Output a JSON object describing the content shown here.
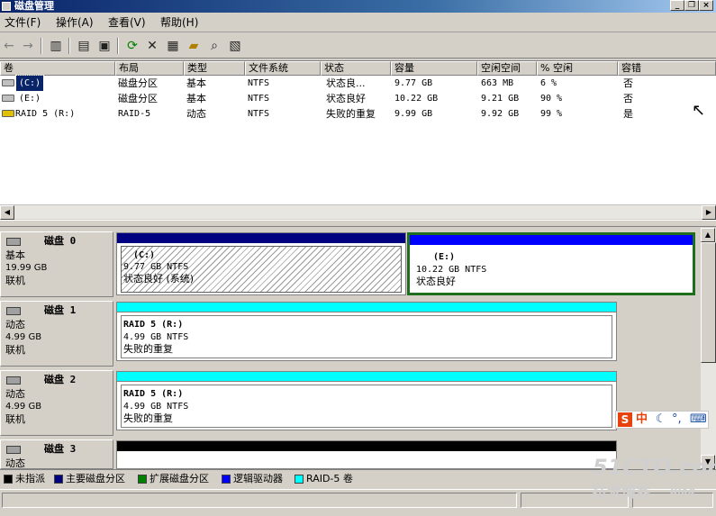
{
  "window": {
    "title": "磁盘管理"
  },
  "menu": {
    "items": [
      "文件(F)",
      "操作(A)",
      "查看(V)",
      "帮助(H)"
    ]
  },
  "toolbar": {
    "icons": [
      "back-arrow-icon",
      "forward-arrow-icon",
      "show-hide-tree-icon",
      "properties-icon",
      "help-icon",
      "refresh-icon",
      "delete-icon",
      "open-icon",
      "explore-icon",
      "search-icon",
      "export-icon"
    ]
  },
  "volume_list": {
    "columns": [
      "卷",
      "布局",
      "类型",
      "文件系统",
      "状态",
      "容量",
      "空闲空间",
      "% 空闲",
      "容错"
    ],
    "rows": [
      {
        "name": "(C:)",
        "layout": "磁盘分区",
        "type": "基本",
        "fs": "NTFS",
        "status": "状态良...",
        "capacity": "9.77 GB",
        "free": "663 MB",
        "pct": "6 %",
        "fault": "否"
      },
      {
        "name": "(E:)",
        "layout": "磁盘分区",
        "type": "基本",
        "fs": "NTFS",
        "status": "状态良好",
        "capacity": "10.22 GB",
        "free": "9.21 GB",
        "pct": "90 %",
        "fault": "否"
      },
      {
        "name": "RAID 5 (R:)",
        "layout": "RAID-5",
        "type": "动态",
        "fs": "NTFS",
        "status": "失败的重复",
        "capacity": "9.99 GB",
        "free": "9.92 GB",
        "pct": "99 %",
        "fault": "是"
      }
    ]
  },
  "disks": [
    {
      "name": "磁盘 0",
      "kind": "基本",
      "size": "19.99 GB",
      "state": "联机",
      "partitions": [
        {
          "title": "(C:)",
          "line2": "9.77 GB NTFS",
          "line3": "状态良好 (系统)"
        },
        {
          "title": "(E:)",
          "line2": "10.22 GB NTFS",
          "line3": "状态良好"
        }
      ]
    },
    {
      "name": "磁盘 1",
      "kind": "动态",
      "size": "4.99 GB",
      "state": "联机",
      "partitions": [
        {
          "title": "RAID 5  (R:)",
          "line2": "4.99 GB NTFS",
          "line3": "失败的重复"
        }
      ]
    },
    {
      "name": "磁盘 2",
      "kind": "动态",
      "size": "4.99 GB",
      "state": "联机",
      "partitions": [
        {
          "title": "RAID 5  (R:)",
          "line2": "4.99 GB NTFS",
          "line3": "失败的重复"
        }
      ]
    },
    {
      "name": "磁盘 3",
      "kind": "动态"
    }
  ],
  "legend": [
    {
      "label": "未指派",
      "color": "#000000"
    },
    {
      "label": "主要磁盘分区",
      "color": "#000080"
    },
    {
      "label": "扩展磁盘分区",
      "color": "#008000"
    },
    {
      "label": "逻辑驱动器",
      "color": "#0000ff"
    },
    {
      "label": "RAID-5 卷",
      "color": "#00ffff"
    }
  ],
  "ime": {
    "labels": [
      "S",
      "中"
    ]
  },
  "watermark": {
    "line1": "51CTO.com",
    "line2": "技术博客",
    "line3": "Blog"
  }
}
